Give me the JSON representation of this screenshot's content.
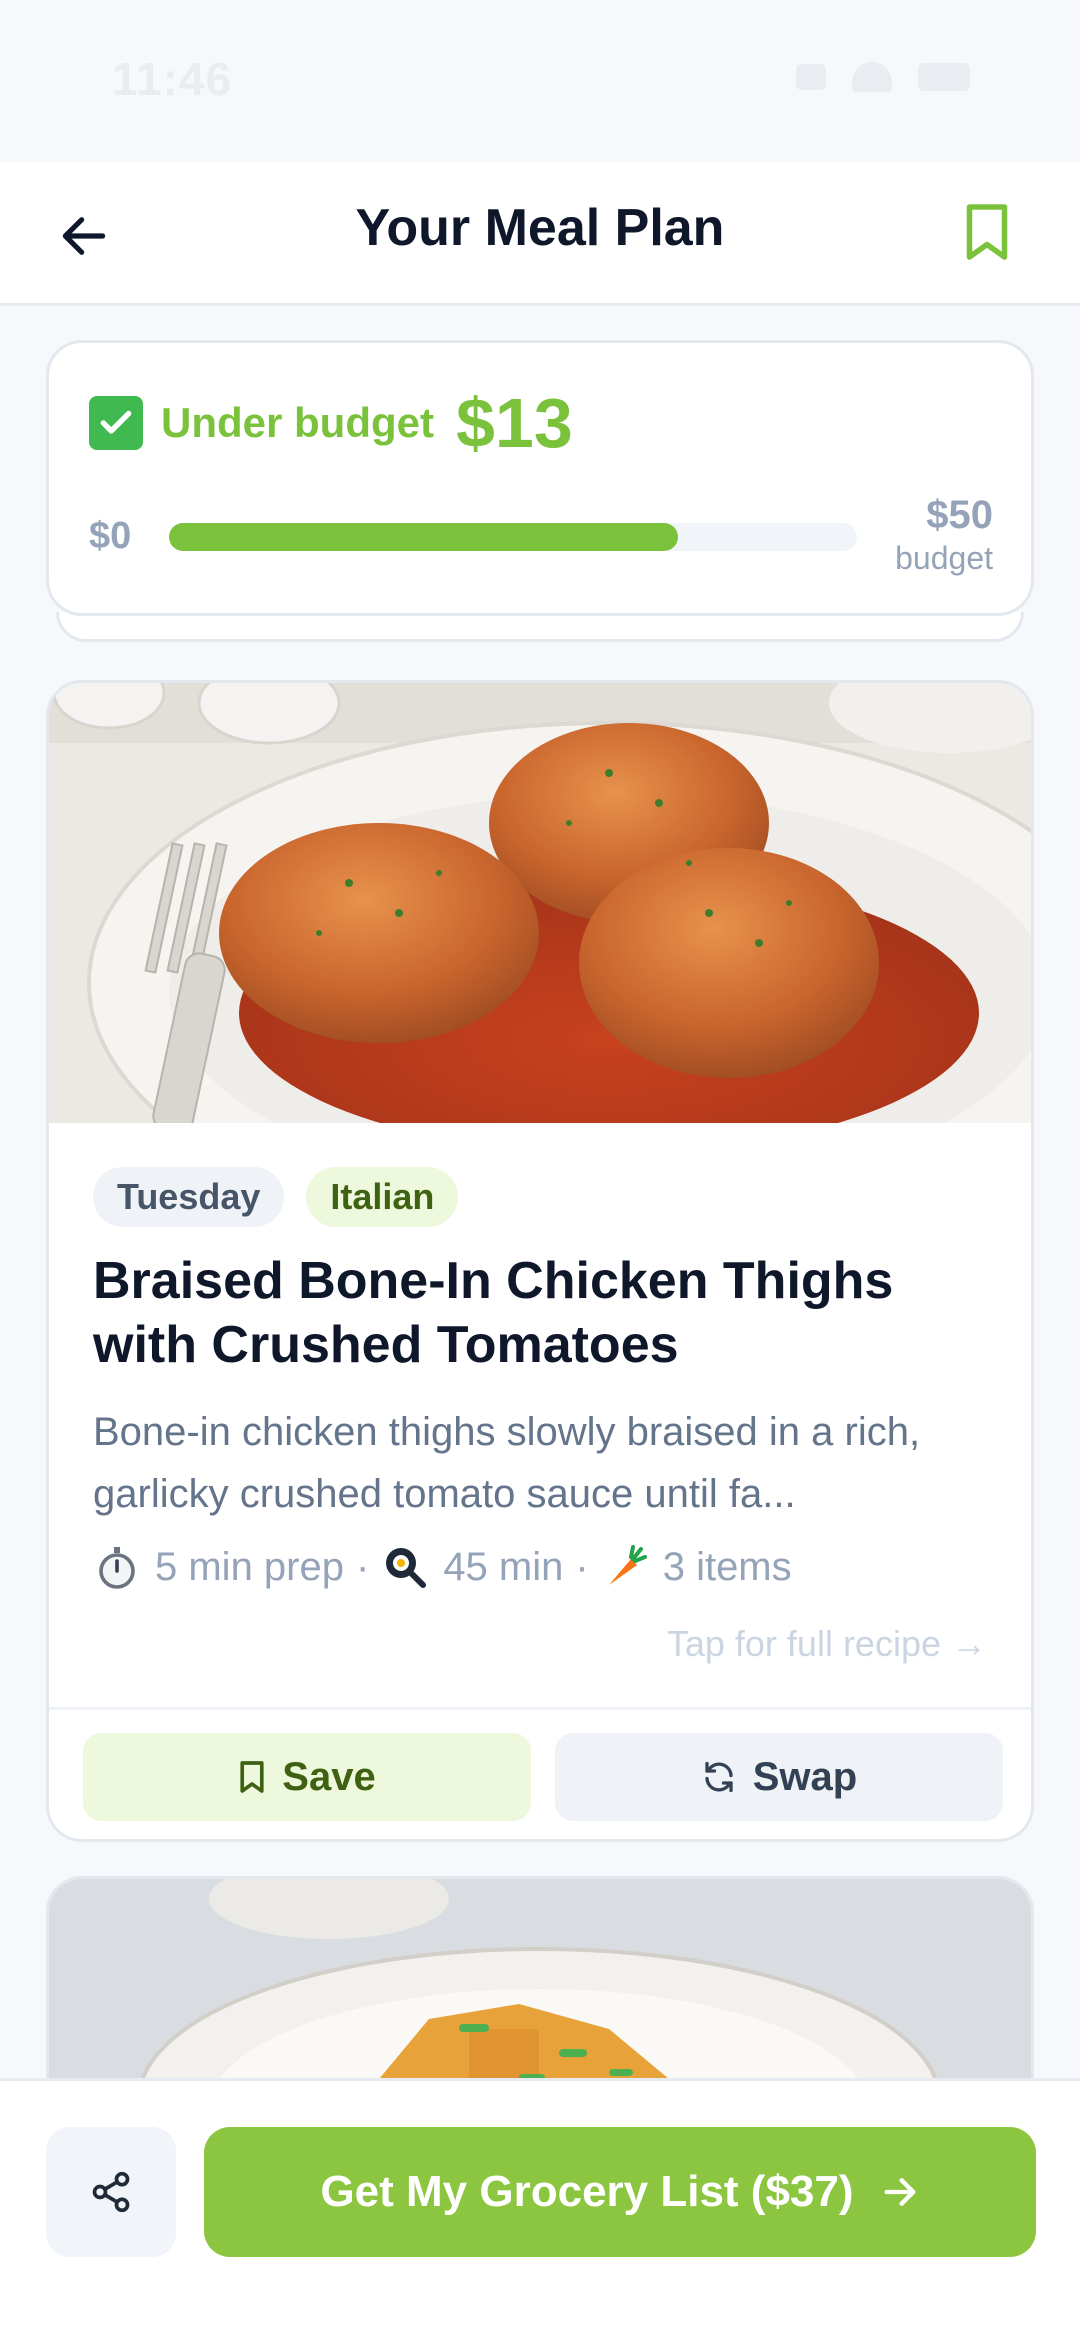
{
  "status_bar": {
    "time": "11:46"
  },
  "header": {
    "title": "Your Meal Plan",
    "back_icon": "arrow-left-icon",
    "bookmark_icon": "bookmark-icon"
  },
  "budget": {
    "status_label": "Under budget",
    "amount": "$13",
    "range_min": "$0",
    "range_max": "$50",
    "range_max_label": "budget",
    "spent_fraction": 0.74,
    "accent_color": "#7bc23c"
  },
  "meal": {
    "day_tag": "Tuesday",
    "cuisine_tag": "Italian",
    "title": "Braised Bone-In Chicken Thighs with Crushed Tomatoes",
    "description": "Bone-in chicken thighs slowly braised in a rich, garlicky crushed tomato sauce until fa...",
    "prep": "5 min prep",
    "cook": "45 min",
    "items": "3 items",
    "separator": "·",
    "full_recipe_link": "Tap for full recipe →",
    "save_label": "Save",
    "swap_label": "Swap"
  },
  "footer": {
    "grocery_button_label": "Get My Grocery List ($37)",
    "primary_color": "#8cc641"
  }
}
